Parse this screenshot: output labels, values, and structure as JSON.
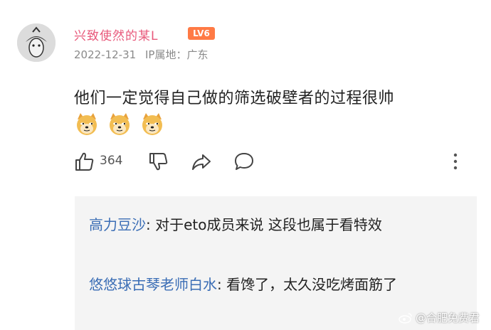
{
  "comment": {
    "username": "兴致使然的某L",
    "level_badge": "LV6",
    "date": "2022-12-31",
    "ip_location": "IP属地：广东",
    "text": "他们一定觉得自己做的筛选破壁者的过程很帅",
    "emojis": [
      "doge-emoji",
      "doge-emoji",
      "doge-emoji"
    ],
    "like_count": "364"
  },
  "replies": [
    {
      "author": "高力豆沙",
      "separator": ": ",
      "text": "对于eto成员来说 这段也属于看特效"
    },
    {
      "author": "悠悠球古琴老师白水",
      "separator": ": ",
      "text": "看馋了，太久没吃烤面筋了"
    }
  ],
  "watermark": "@合肥免费君",
  "colors": {
    "username": "#e8587a",
    "level_badge": "#ff7a45",
    "reply_author": "#3a6db5",
    "meta_text": "#8a8a8a",
    "reply_background": "#f4f4f4"
  }
}
